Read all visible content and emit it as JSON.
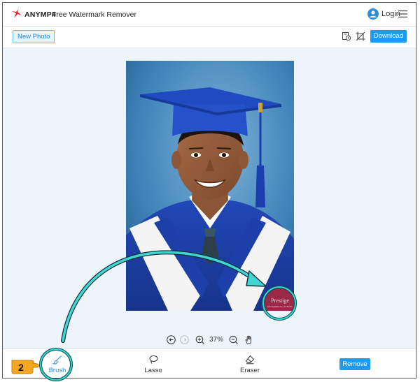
{
  "header": {
    "brand": "ANYMP4",
    "title": "Free Watermark Remover",
    "login_label": "Login"
  },
  "toolbar": {
    "new_photo_label": "New Photo",
    "download_label": "Download"
  },
  "canvas": {
    "zoom_label": "37%",
    "watermark": {
      "text": "Prestige",
      "subtext": "Photography by | Hollands"
    }
  },
  "tools": {
    "brush_label": "Brush",
    "lasso_label": "Lasso",
    "eraser_label": "Eraser",
    "remove_label": "Remove"
  },
  "annotation": {
    "step_number": "2"
  },
  "colors": {
    "accent": "#1e9bef",
    "highlight": "#2ad0d0",
    "badge": "#f5a623"
  }
}
